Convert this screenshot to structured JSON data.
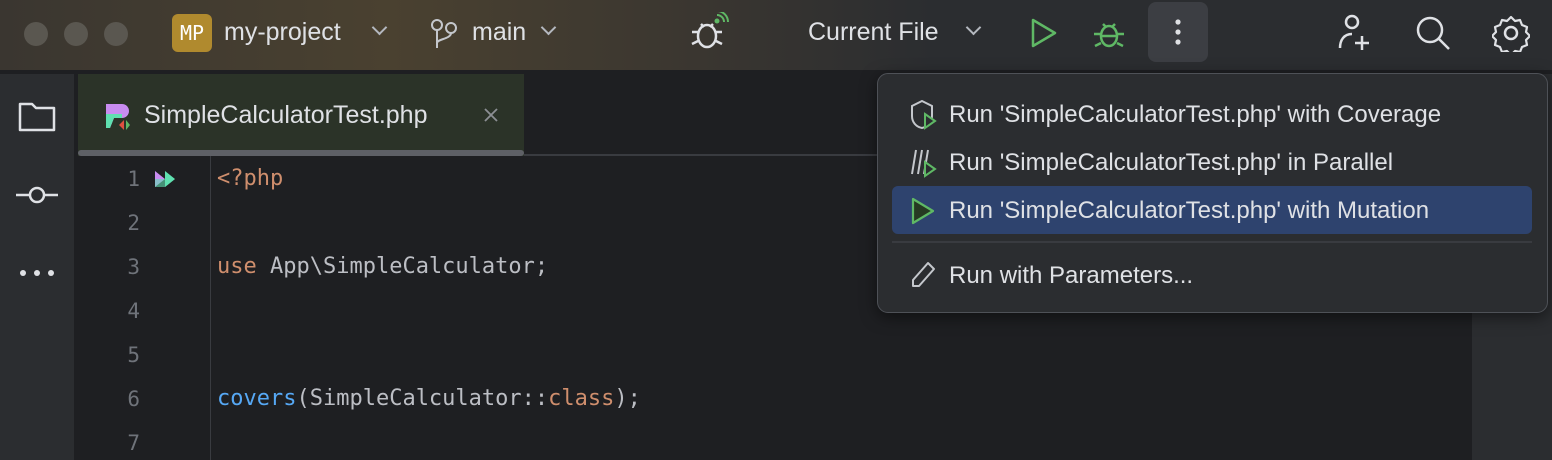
{
  "titlebar": {
    "project_badge": "MP",
    "project_name": "my-project",
    "branch": "main",
    "run_config": "Current File"
  },
  "tab": {
    "filename": "SimpleCalculatorTest.php"
  },
  "editor": {
    "line_numbers": [
      "1",
      "2",
      "3",
      "4",
      "5",
      "6",
      "7"
    ],
    "lines": {
      "l1": "<?php",
      "l3_kw": "use",
      "l3_rest": " App\\SimpleCalculator;",
      "l6_fn": "covers",
      "l6_mid": "(SimpleCalculator::",
      "l6_kw": "class",
      "l6_end": ");"
    }
  },
  "menu": {
    "items": [
      {
        "label": "Run 'SimpleCalculatorTest.php' with Coverage",
        "icon": "coverage-icon"
      },
      {
        "label": "Run 'SimpleCalculatorTest.php' in Parallel",
        "icon": "parallel-icon"
      },
      {
        "label": "Run 'SimpleCalculatorTest.php' with Mutation",
        "icon": "run-icon",
        "selected": true
      },
      {
        "label": "Run with Parameters...",
        "icon": "pencil-icon"
      }
    ]
  },
  "colors": {
    "accent_green": "#5fb865",
    "selection": "#2e436e",
    "keyword": "#cf8e6d",
    "function": "#56a8f5"
  }
}
